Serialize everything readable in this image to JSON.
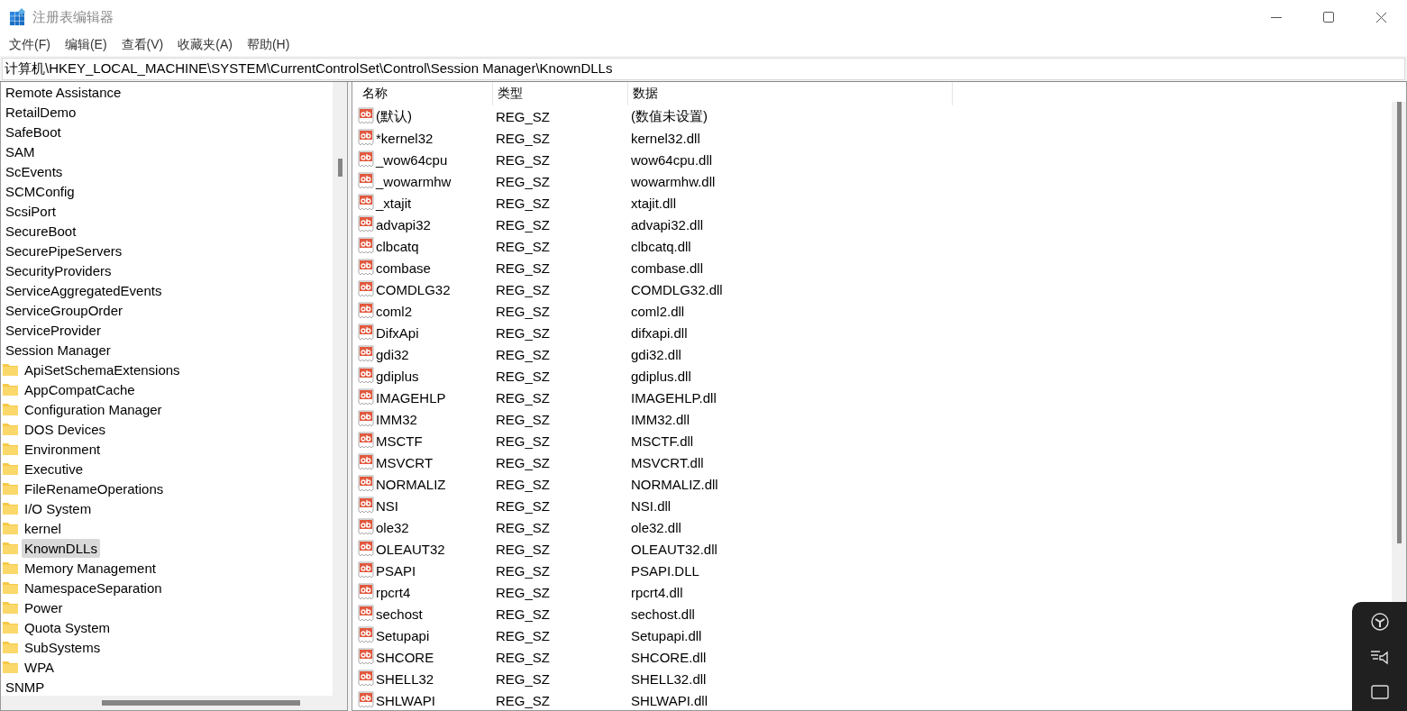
{
  "window": {
    "title": "注册表编辑器"
  },
  "menu": [
    "文件(F)",
    "编辑(E)",
    "查看(V)",
    "收藏夹(A)",
    "帮助(H)"
  ],
  "address": "计算机\\HKEY_LOCAL_MACHINE\\SYSTEM\\CurrentControlSet\\Control\\Session Manager\\KnownDLLs",
  "tree": [
    {
      "label": "Remote Assistance",
      "selected": false
    },
    {
      "label": "RetailDemo",
      "selected": false
    },
    {
      "label": "SafeBoot",
      "selected": false
    },
    {
      "label": "SAM",
      "selected": false
    },
    {
      "label": "ScEvents",
      "selected": false
    },
    {
      "label": "SCMConfig",
      "selected": false
    },
    {
      "label": "ScsiPort",
      "selected": false
    },
    {
      "label": "SecureBoot",
      "selected": false
    },
    {
      "label": "SecurePipeServers",
      "selected": false
    },
    {
      "label": "SecurityProviders",
      "selected": false
    },
    {
      "label": "ServiceAggregatedEvents",
      "selected": false
    },
    {
      "label": "ServiceGroupOrder",
      "selected": false
    },
    {
      "label": "ServiceProvider",
      "selected": false
    },
    {
      "label": "Session Manager",
      "selected": false,
      "children": [
        {
          "label": "ApiSetSchemaExtensions",
          "selected": false
        },
        {
          "label": "AppCompatCache",
          "selected": false
        },
        {
          "label": "Configuration Manager",
          "selected": false
        },
        {
          "label": "DOS Devices",
          "selected": false
        },
        {
          "label": "Environment",
          "selected": false
        },
        {
          "label": "Executive",
          "selected": false
        },
        {
          "label": "FileRenameOperations",
          "selected": false
        },
        {
          "label": "I/O System",
          "selected": false
        },
        {
          "label": "kernel",
          "selected": false
        },
        {
          "label": "KnownDLLs",
          "selected": true
        },
        {
          "label": "Memory Management",
          "selected": false
        },
        {
          "label": "NamespaceSeparation",
          "selected": false
        },
        {
          "label": "Power",
          "selected": false
        },
        {
          "label": "Quota System",
          "selected": false
        },
        {
          "label": "SubSystems",
          "selected": false
        },
        {
          "label": "WPA",
          "selected": false
        }
      ]
    },
    {
      "label": "SNMP",
      "selected": false
    }
  ],
  "table": {
    "columns": [
      "名称",
      "类型",
      "数据"
    ],
    "rows": [
      {
        "name": "(默认)",
        "type": "REG_SZ",
        "data": "(数值未设置)"
      },
      {
        "name": "*kernel32",
        "type": "REG_SZ",
        "data": "kernel32.dll"
      },
      {
        "name": "_wow64cpu",
        "type": "REG_SZ",
        "data": "wow64cpu.dll"
      },
      {
        "name": "_wowarmhw",
        "type": "REG_SZ",
        "data": "wowarmhw.dll"
      },
      {
        "name": "_xtajit",
        "type": "REG_SZ",
        "data": "xtajit.dll"
      },
      {
        "name": "advapi32",
        "type": "REG_SZ",
        "data": "advapi32.dll"
      },
      {
        "name": "clbcatq",
        "type": "REG_SZ",
        "data": "clbcatq.dll"
      },
      {
        "name": "combase",
        "type": "REG_SZ",
        "data": "combase.dll"
      },
      {
        "name": "COMDLG32",
        "type": "REG_SZ",
        "data": "COMDLG32.dll"
      },
      {
        "name": "coml2",
        "type": "REG_SZ",
        "data": "coml2.dll"
      },
      {
        "name": "DifxApi",
        "type": "REG_SZ",
        "data": "difxapi.dll"
      },
      {
        "name": "gdi32",
        "type": "REG_SZ",
        "data": "gdi32.dll"
      },
      {
        "name": "gdiplus",
        "type": "REG_SZ",
        "data": "gdiplus.dll"
      },
      {
        "name": "IMAGEHLP",
        "type": "REG_SZ",
        "data": "IMAGEHLP.dll"
      },
      {
        "name": "IMM32",
        "type": "REG_SZ",
        "data": "IMM32.dll"
      },
      {
        "name": "MSCTF",
        "type": "REG_SZ",
        "data": "MSCTF.dll"
      },
      {
        "name": "MSVCRT",
        "type": "REG_SZ",
        "data": "MSVCRT.dll"
      },
      {
        "name": "NORMALIZ",
        "type": "REG_SZ",
        "data": "NORMALIZ.dll"
      },
      {
        "name": "NSI",
        "type": "REG_SZ",
        "data": "NSI.dll"
      },
      {
        "name": "ole32",
        "type": "REG_SZ",
        "data": "ole32.dll"
      },
      {
        "name": "OLEAUT32",
        "type": "REG_SZ",
        "data": "OLEAUT32.dll"
      },
      {
        "name": "PSAPI",
        "type": "REG_SZ",
        "data": "PSAPI.DLL"
      },
      {
        "name": "rpcrt4",
        "type": "REG_SZ",
        "data": "rpcrt4.dll"
      },
      {
        "name": "sechost",
        "type": "REG_SZ",
        "data": "sechost.dll"
      },
      {
        "name": "Setupapi",
        "type": "REG_SZ",
        "data": "Setupapi.dll"
      },
      {
        "name": "SHCORE",
        "type": "REG_SZ",
        "data": "SHCORE.dll"
      },
      {
        "name": "SHELL32",
        "type": "REG_SZ",
        "data": "SHELL32.dll"
      },
      {
        "name": "SHLWAPI",
        "type": "REG_SZ",
        "data": "SHLWAPI.dll"
      }
    ]
  }
}
